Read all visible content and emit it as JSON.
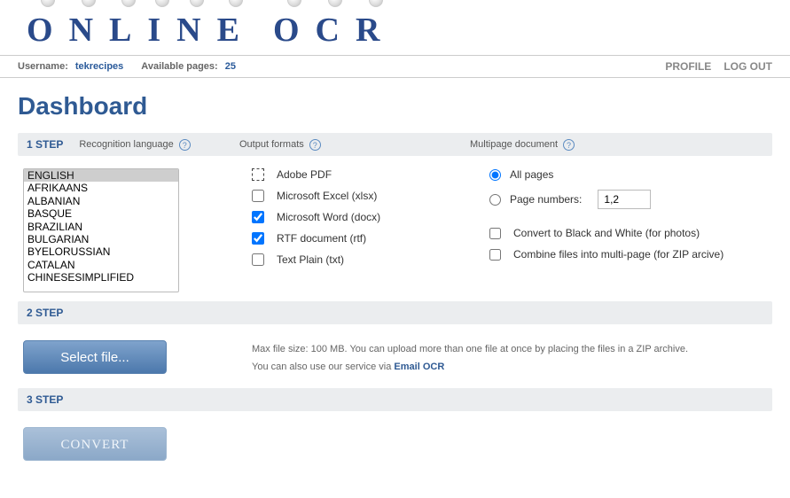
{
  "logo": "ONLINE OCR",
  "topbar": {
    "username_label": "Username:",
    "username": "tekrecipes",
    "pages_label": "Available pages:",
    "pages": "25",
    "profile": "PROFILE",
    "logout": "LOG OUT"
  },
  "title": "Dashboard",
  "step1": {
    "step_label": "1 STEP",
    "lang_label": "Recognition language",
    "output_label": "Output formats",
    "multipage_label": "Multipage document",
    "languages": [
      "ENGLISH",
      "AFRIKAANS",
      "ALBANIAN",
      "BASQUE",
      "BRAZILIAN",
      "BULGARIAN",
      "BYELORUSSIAN",
      "CATALAN",
      "CHINESESIMPLIFIED"
    ],
    "outputs": {
      "pdf": "Adobe PDF",
      "xlsx": "Microsoft Excel (xlsx)",
      "docx": "Microsoft Word (docx)",
      "rtf": "RTF document (rtf)",
      "txt": "Text Plain (txt)"
    },
    "multipage": {
      "all": "All pages",
      "numbers": "Page numbers:",
      "numbers_value": "1,2",
      "bw": "Convert to Black and White (for photos)",
      "combine": "Combine files into multi-page (for ZIP arcive)"
    }
  },
  "step2": {
    "step_label": "2 STEP",
    "button": "Select file...",
    "text1": "Max file size: 100 MB. You can upload more than one file at once by placing the files in a ZIP archive.",
    "text2a": "You can also use our service via ",
    "text2b": "Email OCR"
  },
  "step3": {
    "step_label": "3 STEP",
    "button": "CONVERT"
  }
}
